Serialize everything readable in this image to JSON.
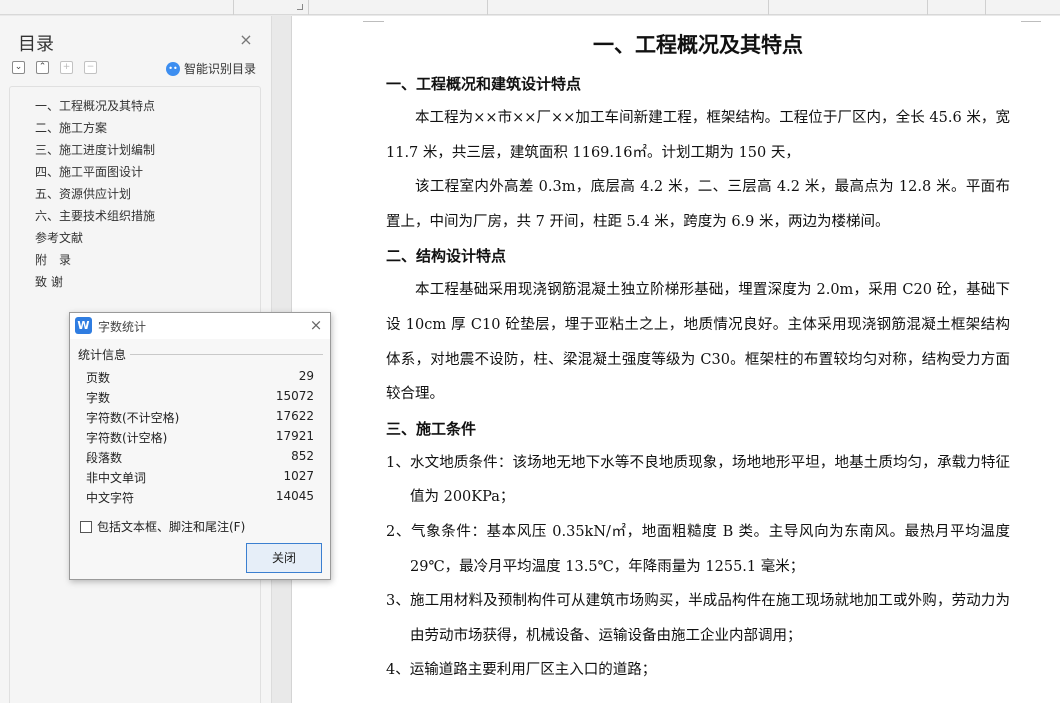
{
  "nav": {
    "title": "目录",
    "close_glyph": "×",
    "tools": [
      {
        "icon": "expand-all-icon",
        "glyph": "⌄"
      },
      {
        "icon": "collapse-all-icon",
        "glyph": "⌃"
      },
      {
        "icon": "add-heading-icon",
        "glyph": "+"
      },
      {
        "icon": "remove-heading-icon",
        "glyph": "−"
      }
    ],
    "smart_label": "智能识别目录",
    "toc": [
      "一、工程概况及其特点",
      "二、施工方案",
      "三、施工进度计划编制",
      "四、施工平面图设计",
      "五、资源供应计划",
      "六、主要技术组织措施",
      "参考文献",
      "附　录",
      "致 谢"
    ]
  },
  "doc": {
    "title": "一、工程概况及其特点",
    "section1": "一、工程概况和建筑设计特点",
    "p1": "本工程为××市××厂××加工车间新建工程，框架结构。工程位于厂区内，全长 45.6 米，宽 11.7 米，共三层，建筑面积 1169.16㎡。计划工期为 150 天，",
    "p2": "该工程室内外高差 0.3m，底层高 4.2 米，二、三层高 4.2 米，最高点为 12.8 米。平面布置上，中间为厂房，共 7 开间，柱距 5.4 米，跨度为 6.9 米，两边为楼梯间。",
    "section2": "二、结构设计特点",
    "p3": "本工程基础采用现浇钢筋混凝土独立阶梯形基础，埋置深度为 2.0m，采用 C20 砼，基础下设 10cm 厚 C10 砼垫层，埋于亚粘土之上，地质情况良好。主体采用现浇钢筋混凝土框架结构体系，对地震不设防，柱、梁混凝土强度等级为 C30。框架柱的布置较均匀对称，结构受力方面较合理。",
    "section3": "三、施工条件",
    "items": [
      "1、水文地质条件：该场地无地下水等不良地质现象，场地地形平坦，地基土质均匀，承载力特征值为 200KPa；",
      "2、气象条件：基本风压 0.35kN/㎡，地面粗糙度 B 类。主导风向为东南风。最热月平均温度 29℃，最冷月平均温度 13.5℃，年降雨量为 1255.1 毫米；",
      "3、施工用材料及预制构件可从建筑市场购买，半成品构件在施工现场就地加工或外购，劳动力为由劳动市场获得，机械设备、运输设备由施工企业内部调用；",
      "4、运输道路主要利用厂区主入口的道路；"
    ]
  },
  "dialog": {
    "logo": "W",
    "title": "字数统计",
    "close_glyph": "×",
    "group_label": "统计信息",
    "stats": [
      {
        "label": "页数",
        "value": "29"
      },
      {
        "label": "字数",
        "value": "15072"
      },
      {
        "label": "字符数(不计空格)",
        "value": "17622"
      },
      {
        "label": "字符数(计空格)",
        "value": "17921"
      },
      {
        "label": "段落数",
        "value": "852"
      },
      {
        "label": "非中文单词",
        "value": "1027"
      },
      {
        "label": "中文字符",
        "value": "14045"
      }
    ],
    "include_label": "包括文本框、脚注和尾注(F)",
    "close_button": "关闭"
  }
}
